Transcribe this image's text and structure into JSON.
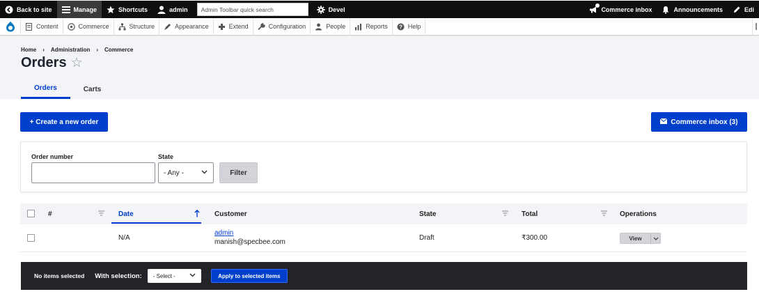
{
  "toolbar": {
    "back_to_site": "Back to site",
    "manage": "Manage",
    "shortcuts": "Shortcuts",
    "user": "admin",
    "search_placeholder": "Admin Toolbar quick search",
    "devel": "Devel",
    "commerce_inbox": "Commerce inbox",
    "announcements": "Announcements",
    "edit": "Edi"
  },
  "admin_menu": {
    "items": [
      {
        "label": "Content",
        "icon": "content-icon"
      },
      {
        "label": "Commerce",
        "icon": "commerce-icon"
      },
      {
        "label": "Structure",
        "icon": "structure-icon"
      },
      {
        "label": "Appearance",
        "icon": "appearance-icon"
      },
      {
        "label": "Extend",
        "icon": "extend-icon"
      },
      {
        "label": "Configuration",
        "icon": "wrench-icon"
      },
      {
        "label": "People",
        "icon": "people-icon"
      },
      {
        "label": "Reports",
        "icon": "reports-icon"
      },
      {
        "label": "Help",
        "icon": "help-icon"
      }
    ]
  },
  "breadcrumb": [
    "Home",
    "Administration",
    "Commerce"
  ],
  "page": {
    "title": "Orders",
    "star": "☆",
    "tabs": [
      "Orders",
      "Carts"
    ]
  },
  "actions": {
    "create_order": "+ Create a new order",
    "commerce_inbox": "Commerce inbox (3)"
  },
  "filters": {
    "order_number_label": "Order number",
    "order_number_value": "",
    "state_label": "State",
    "state_value": "- Any -",
    "filter_button": "Filter"
  },
  "table": {
    "columns": [
      "#",
      "Date",
      "Customer",
      "State",
      "Total",
      "Operations"
    ],
    "sorted_column": "Date",
    "rows": [
      {
        "number": "",
        "date": "N/A",
        "customer_name": "admin",
        "customer_email": "manish@specbee.com",
        "state": "Draft",
        "total": "₹300.00",
        "operation": "View"
      }
    ]
  },
  "bulk": {
    "status": "No items selected",
    "with_selection": "With selection:",
    "select_value": "- Select -",
    "apply": "Apply to selected items"
  },
  "colors": {
    "primary": "#003ecc",
    "toolbar_bg": "#0f0f0f",
    "header_bg": "#f3f4f7",
    "bulk_bg": "#232429"
  }
}
